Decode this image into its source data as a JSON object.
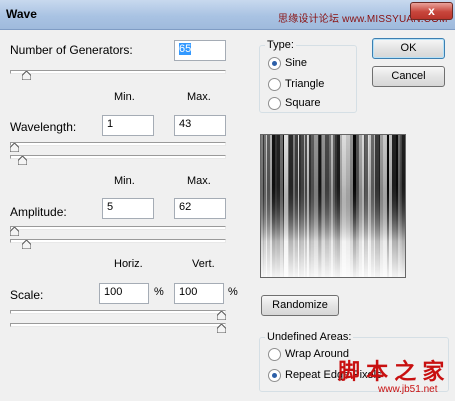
{
  "window": {
    "title": "Wave",
    "close_glyph": "x"
  },
  "watermarks": {
    "top": "思缘设计论坛 www.MISSYUAN.COM",
    "bottom": "脚 本 之 家",
    "url": "www.jb51.net"
  },
  "generators": {
    "label": "Number of Generators:",
    "value": "65",
    "slider_fraction": 0.06
  },
  "min_header": "Min.",
  "max_header": "Max.",
  "wavelength": {
    "label": "Wavelength:",
    "min": "1",
    "max": "43",
    "min_fraction": 0.0,
    "max_fraction": 0.04
  },
  "amplitude": {
    "label": "Amplitude:",
    "min": "5",
    "max": "62",
    "min_fraction": 0.0,
    "max_fraction": 0.06
  },
  "horiz_header": "Horiz.",
  "vert_header": "Vert.",
  "scale": {
    "label": "Scale:",
    "horiz": "100",
    "vert": "100",
    "unit": "%",
    "horiz_fraction": 1.0,
    "vert_fraction": 1.0
  },
  "type": {
    "label": "Type:",
    "options": [
      {
        "label": "Sine",
        "selected": true
      },
      {
        "label": "Triangle",
        "selected": false
      },
      {
        "label": "Square",
        "selected": false
      }
    ]
  },
  "buttons": {
    "ok": "OK",
    "cancel": "Cancel",
    "randomize": "Randomize"
  },
  "undefined_areas": {
    "label": "Undefined Areas:",
    "options": [
      {
        "label": "Wrap Around",
        "selected": false
      },
      {
        "label": "Repeat Edge Pixels",
        "selected": true
      }
    ]
  }
}
